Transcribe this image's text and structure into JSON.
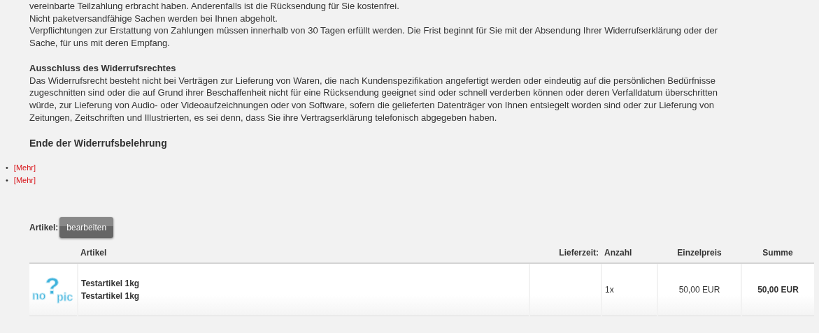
{
  "terms": [
    {
      "kind": "paragraph",
      "lines": [
        "vereinbarte Teilzahlung erbracht haben. Anderenfalls ist die Rücksendung für Sie kostenfrei.",
        "Nicht paketversandfähige Sachen werden bei Ihnen abgeholt.",
        "Verpflichtungen zur Erstattung von Zahlungen müssen innerhalb von 30 Tagen erfüllt werden. Die Frist beginnt für Sie mit der Absendung Ihrer Widerrufserklärung oder der",
        "Sache, für uns mit deren Empfang."
      ]
    },
    {
      "kind": "subheading",
      "lines": [
        "Ausschluss des Widerrufsrechtes"
      ]
    },
    {
      "kind": "paragraph",
      "lines": [
        "Das Widerrufsrecht besteht nicht bei Verträgen zur Lieferung von Waren, die nach Kundenspezifikation angefertigt werden oder eindeutig auf die persönlichen Bedürfnisse",
        "zugeschnitten sind oder die auf Grund ihrer Beschaffenheit nicht für eine Rücksendung geeignet sind oder schnell verderben können oder deren Verfalldatum überschritten",
        "würde, zur Lieferung von Audio- oder Videoaufzeichnungen oder von Software, sofern die gelieferten Datenträger von Ihnen entsiegelt worden sind oder zur Lieferung von",
        "Zeitungen, Zeitschriften und Illustrierten, es sei denn, dass Sie ihre Vertragserklärung telefonisch abgegeben haben."
      ]
    },
    {
      "kind": "heading",
      "lines": [
        "Ende der Widerrufsbelehrung"
      ]
    }
  ],
  "more_links": [
    {
      "bullet": "•",
      "text": "[Mehr]"
    },
    {
      "bullet": "•",
      "text": "[Mehr]"
    }
  ],
  "cart": {
    "label": "Artikel:",
    "edit_button": "bearbeiten",
    "columns": [
      "Artikel",
      "Lieferzeit:",
      "Anzahl",
      "Einzelpreis",
      "Summe"
    ],
    "rows": [
      {
        "image_logo": {
          "left": "no",
          "mark": "?",
          "right": "pic"
        },
        "names": [
          "Testartikel 1kg",
          "Testartikel 1kg"
        ],
        "quantity": "1x",
        "unit_price": "50,00 EUR",
        "total": "50,00 EUR"
      }
    ]
  }
}
